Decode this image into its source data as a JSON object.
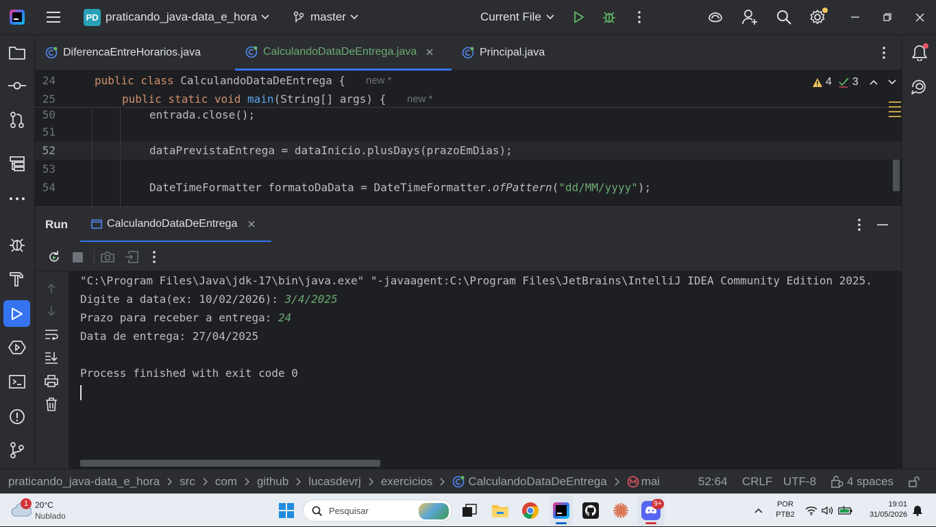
{
  "titlebar": {
    "project_badge": "PD",
    "project_name": "praticando_java-data_e_hora",
    "branch": "master",
    "run_config": "Current File"
  },
  "tabs": [
    {
      "label": "DiferencaEntreHorarios.java"
    },
    {
      "label": "CalculandoDataDeEntrega.java"
    },
    {
      "label": "Principal.java"
    }
  ],
  "editor": {
    "sticky": [
      {
        "num": "24",
        "code": "public class CalculandoDataDeEntrega {",
        "hint": "new *"
      },
      {
        "num": "25",
        "code": "public static void main(String[] args) {",
        "hint": "new *"
      }
    ],
    "lines": [
      {
        "num": "50",
        "code": "entrada.close();"
      },
      {
        "num": "51",
        "code": ""
      },
      {
        "num": "52",
        "code": "dataPrevistaEntrega = dataInicio.plusDays(prazoEmDias);"
      },
      {
        "num": "53",
        "code": ""
      },
      {
        "num": "54",
        "code": "DateTimeFormatter formatoDaData = DateTimeFormatter.ofPattern(\"dd/MM/yyyy\");"
      }
    ],
    "warnings": "4",
    "checks": "3"
  },
  "run": {
    "title": "Run",
    "tab_label": "CalculandoDataDeEntrega"
  },
  "console": {
    "command": "\"C:\\Program Files\\Java\\jdk-17\\bin\\java.exe\" \"-javaagent:C:\\Program Files\\JetBrains\\IntelliJ IDEA Community Edition 2025.",
    "prompt1": "Digite a data(ex: 10/02/2026): ",
    "input1": "3/4/2025",
    "prompt2": "Prazo para receber a entrega: ",
    "input2": "24",
    "result": "Data de entrega: 27/04/2025",
    "exit": "Process finished with exit code 0"
  },
  "statusbar": {
    "breadcrumbs": [
      "praticando_java-data_e_hora",
      "src",
      "com",
      "github",
      "lucasdevrj",
      "exercicios",
      "CalculandoDataDeEntrega",
      "mai"
    ],
    "position": "52:64",
    "line_ending": "CRLF",
    "encoding": "UTF-8",
    "indent": "4 spaces"
  },
  "taskbar": {
    "weather_badge": "1",
    "temperature": "20°C",
    "condition": "Nublado",
    "search_placeholder": "Pesquisar",
    "discord_badge": "9+",
    "language": "POR",
    "layout": "PTB2",
    "time": "19:01",
    "date": "31/05/2026"
  },
  "colors": {
    "accent": "#3574f0",
    "keyword": "#cf8e6d",
    "function": "#56a8f5",
    "string": "#6aab73",
    "run_green": "#5fb865"
  }
}
